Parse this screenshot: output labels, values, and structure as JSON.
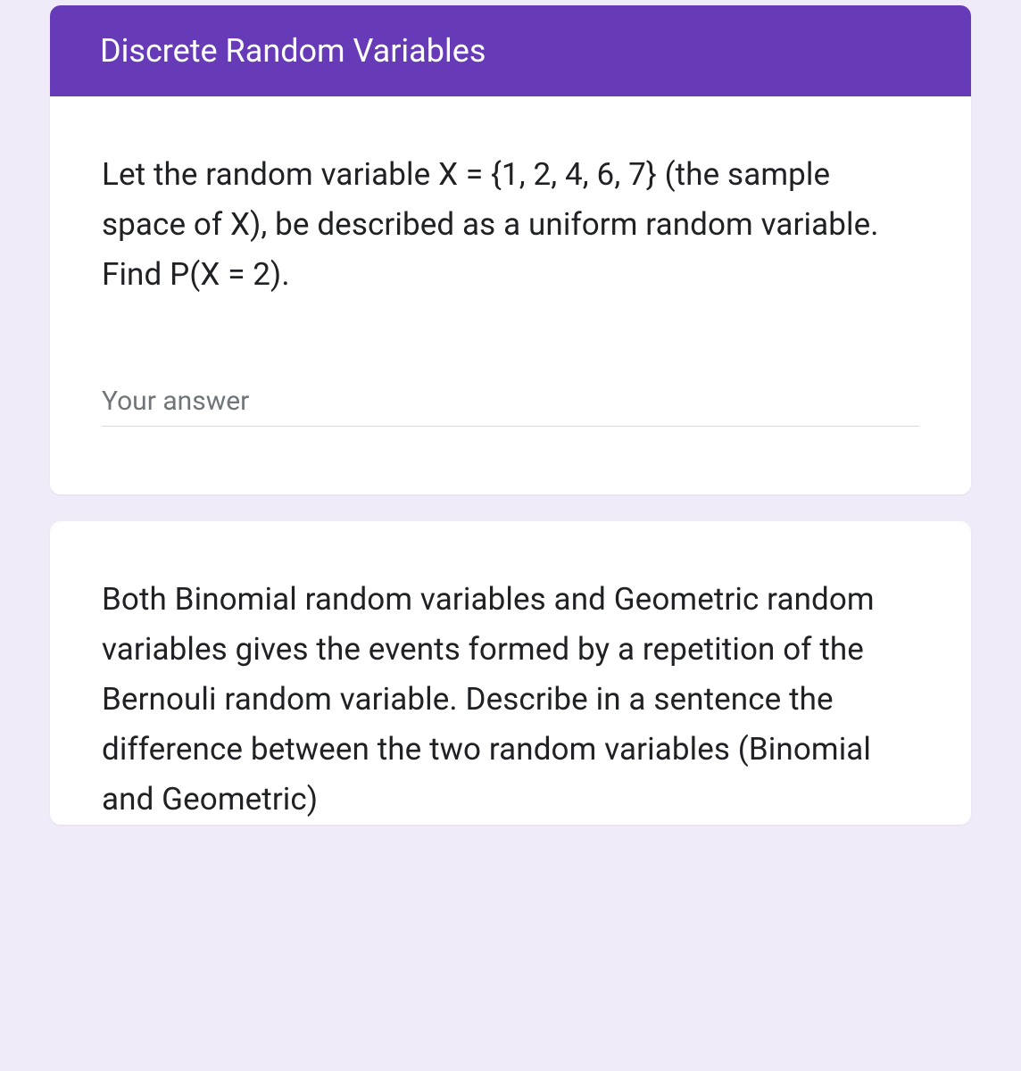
{
  "section": {
    "title": "Discrete Random Variables"
  },
  "questions": [
    {
      "prompt": "Let the random variable X = {1, 2, 4, 6, 7} (the sample space of X), be described as a uniform random variable. Find P(X = 2).",
      "answerPlaceholder": "Your answer"
    },
    {
      "prompt": "Both Binomial random variables and Geometric random variables gives the events formed by a repetition of the Bernouli random variable. Describe in a sentence the difference between the two random variables (Binomial and Geometric)"
    }
  ]
}
